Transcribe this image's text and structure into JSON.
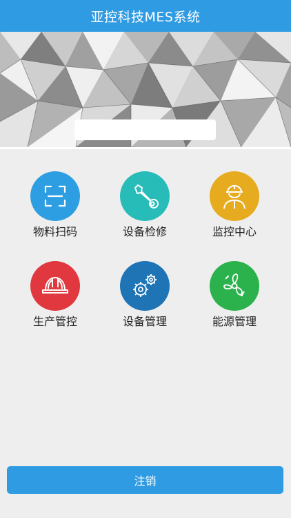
{
  "header": {
    "title": "亚控科技MES系统"
  },
  "banner": {
    "field_value": ""
  },
  "menu": [
    {
      "label": "物料扫码",
      "icon": "scan-icon",
      "color": "#2e9ee3"
    },
    {
      "label": "设备检修",
      "icon": "wrench-icon",
      "color": "#27bcb8"
    },
    {
      "label": "监控中心",
      "icon": "worker-icon",
      "color": "#e6ab1f"
    },
    {
      "label": "生产管控",
      "icon": "hardhat-icon",
      "color": "#e0383e"
    },
    {
      "label": "设备管理",
      "icon": "gears-icon",
      "color": "#1e74b5"
    },
    {
      "label": "能源管理",
      "icon": "fan-icon",
      "color": "#2bb24c"
    }
  ],
  "footer": {
    "logout_label": "注销"
  }
}
